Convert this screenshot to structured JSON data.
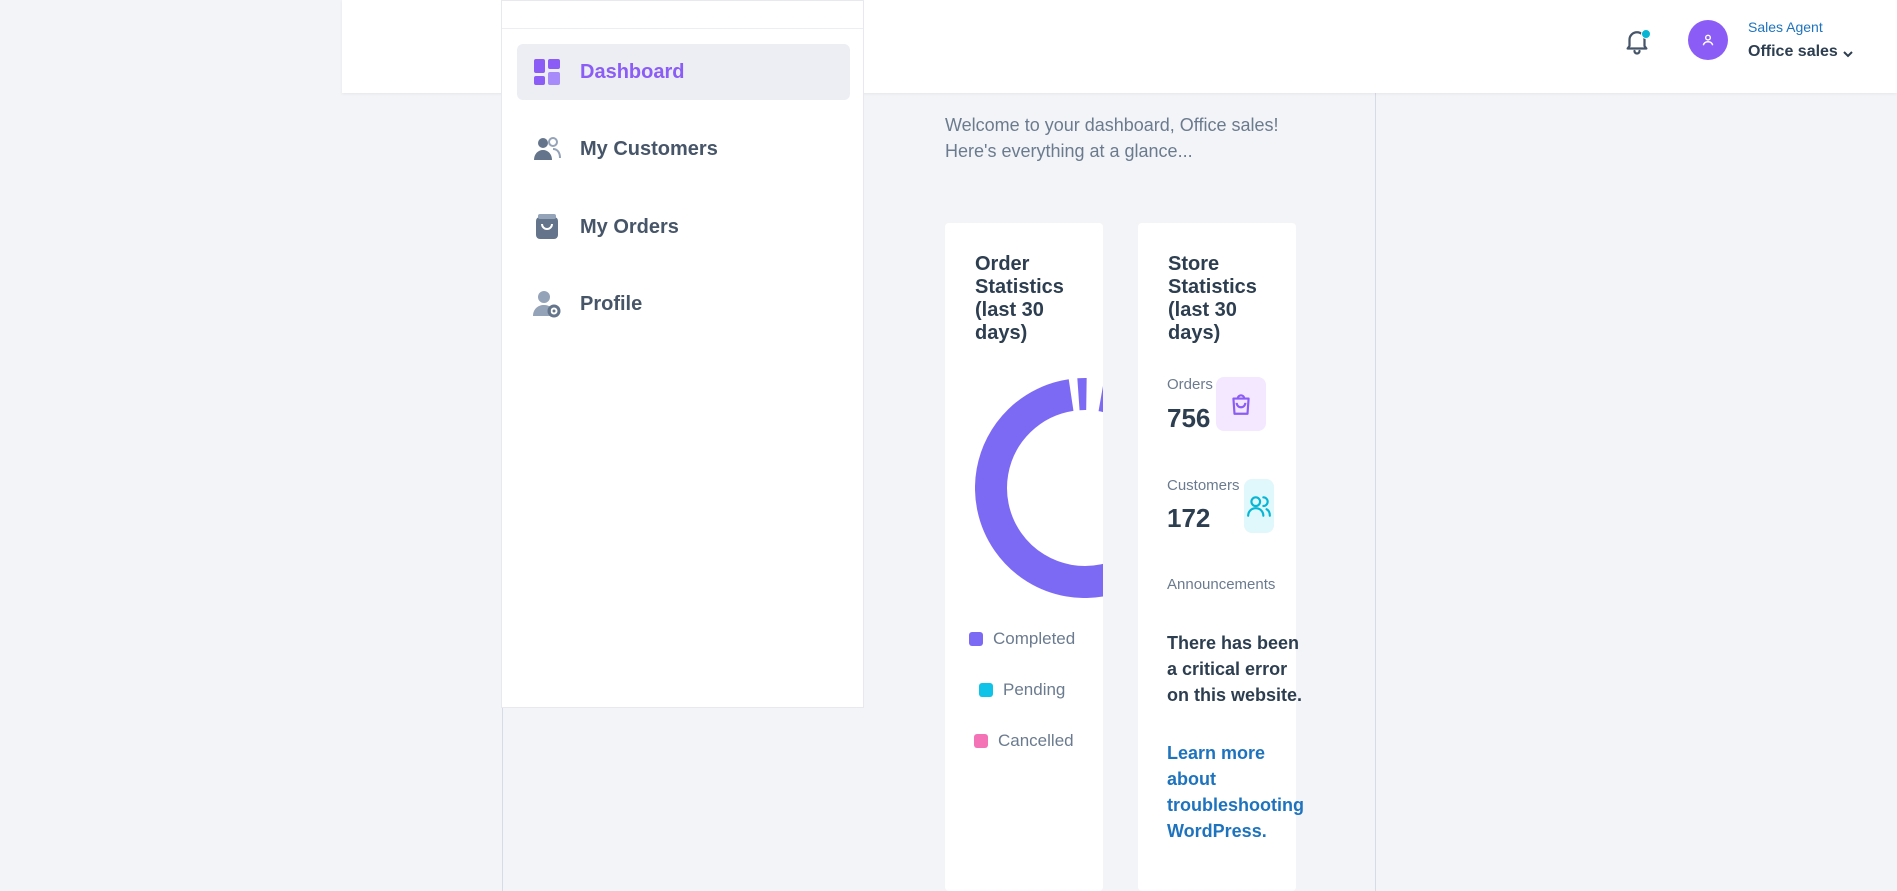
{
  "user": {
    "role": "Sales Agent",
    "name": "Office sales"
  },
  "sidebar": {
    "items": [
      {
        "label": "Dashboard",
        "icon": "dashboard-grid-icon",
        "active": true
      },
      {
        "label": "My Customers",
        "icon": "customers-icon",
        "active": false
      },
      {
        "label": "My Orders",
        "icon": "shopping-bag-icon",
        "active": false
      },
      {
        "label": "Profile",
        "icon": "user-gear-icon",
        "active": false
      }
    ]
  },
  "welcome": {
    "line1": "Welcome to your dashboard, Office sales!",
    "line2": "Here's everything at a glance..."
  },
  "order_stats": {
    "title": "Order Statistics (last 30 days)",
    "legend": [
      {
        "label": "Completed",
        "color": "#7c6af5"
      },
      {
        "label": "Pending",
        "color": "#0ec2e8"
      },
      {
        "label": "Cancelled",
        "color": "#f472b6"
      }
    ]
  },
  "store_stats": {
    "title": "Store Statistics (last 30 days)",
    "orders_label": "Orders",
    "orders_value": "756",
    "customers_label": "Customers",
    "customers_value": "172",
    "announcements_label": "Announcements",
    "announcement_text": "There has been a critical error on this website.",
    "announcement_link": "Learn more about troubleshooting WordPress."
  },
  "colors": {
    "accent": "#8b5cf6",
    "link": "#1e73be",
    "notification_dot": "#06b6d4"
  }
}
